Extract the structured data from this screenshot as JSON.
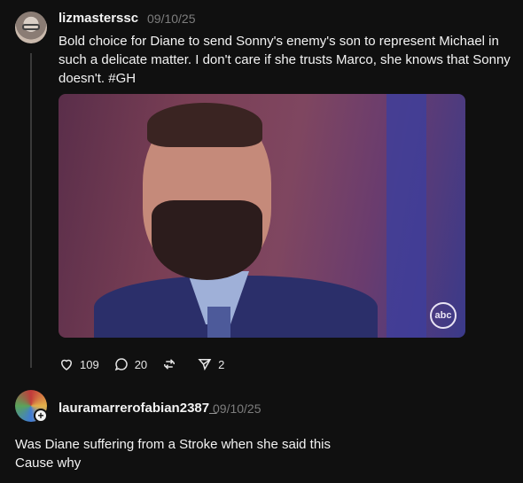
{
  "post": {
    "username": "lizmasterssc",
    "date": "09/10/25",
    "text": "Bold choice for Diane to send Sonny's enemy's son to represent Michael in such a delicate matter. I don't care if she trusts Marco, she knows that Sonny doesn't. #GH",
    "media": {
      "watermark": "abc"
    },
    "actions": {
      "likes": "109",
      "replies": "20",
      "shares": "2"
    }
  },
  "reply": {
    "username": "lauramarrerofabian2387_",
    "date": "09/10/25",
    "lines": [
      "Was Diane suffering from a Stroke when she said this",
      "Cause why"
    ]
  }
}
